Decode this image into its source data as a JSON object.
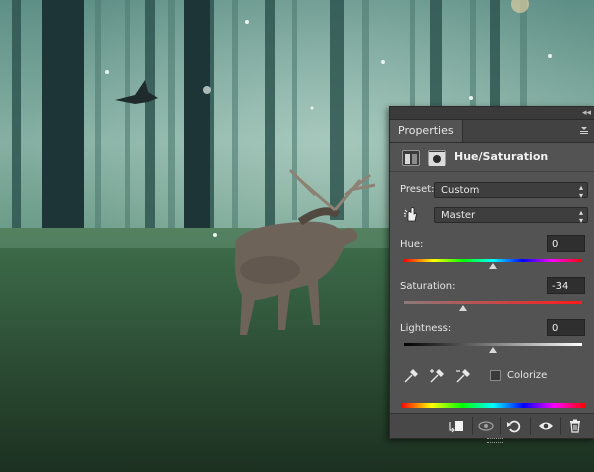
{
  "panel": {
    "tab_label": "Properties",
    "title": "Hue/Saturation",
    "preset_label": "Preset:",
    "preset_value": "Custom",
    "channel_value": "Master",
    "hue": {
      "label": "Hue:",
      "value": "0",
      "level": 0.5
    },
    "saturation": {
      "label": "Saturation:",
      "value": "-34",
      "level": 0.33
    },
    "lightness": {
      "label": "Lightness:",
      "value": "0",
      "level": 0.5
    },
    "colorize_label": "Colorize"
  },
  "icons": {
    "collapse": "double-chevron-icon",
    "menu": "panel-menu-icon",
    "adjustment_layer": "adjustment-layer-icon",
    "mask": "mask-icon",
    "targeted_adjustment": "hand-cursor-icon",
    "eyedropper": "eyedropper-icon",
    "eyedropper_add": "eyedropper-plus-icon",
    "eyedropper_subtract": "eyedropper-minus-icon",
    "clip": "clip-to-layer-icon",
    "view_previous": "eye-previous-icon",
    "reset": "reset-icon",
    "visibility": "eye-icon",
    "delete": "trash-icon"
  },
  "colors": {
    "panel_bg": "#535353",
    "forest_dark": "#1f3a2e",
    "forest_light": "#8fb7a7",
    "ground": "#2c4a2e"
  }
}
